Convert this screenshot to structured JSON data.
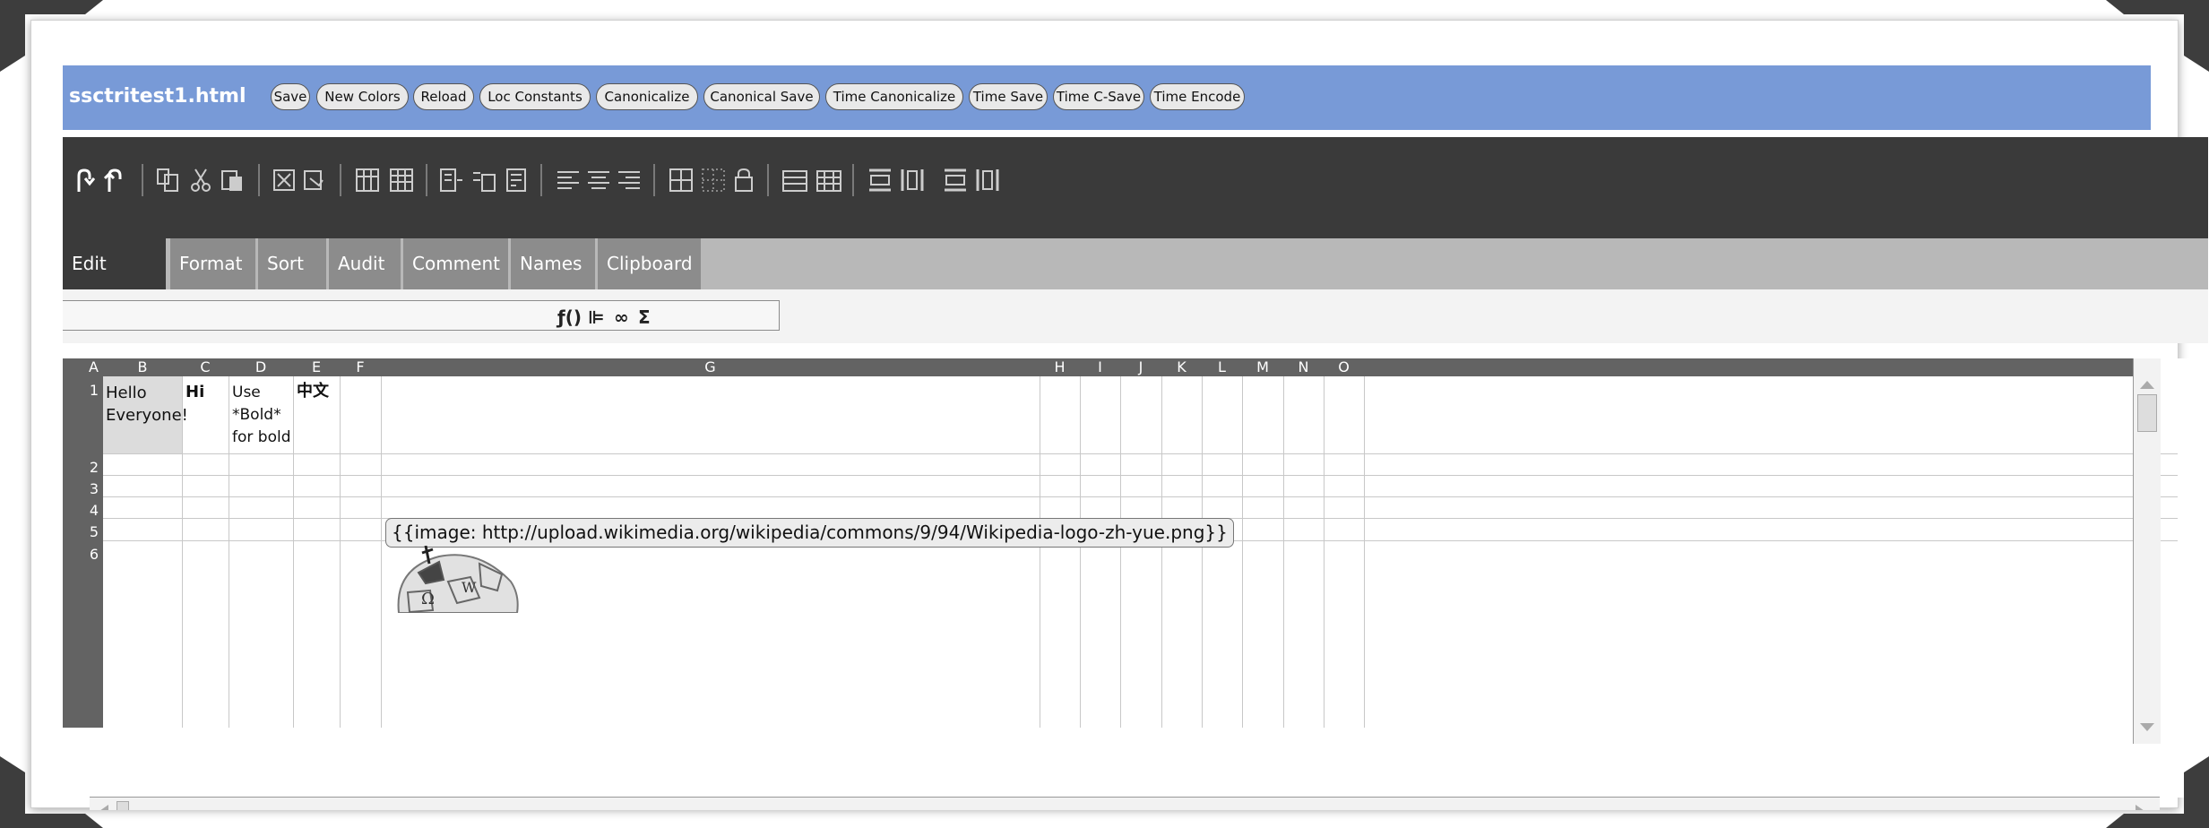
{
  "toolbar_title": {
    "filename": "ssctritest1.html",
    "buttons": [
      "Save",
      "New Colors",
      "Reload",
      "Loc Constants",
      "Canonicalize",
      "Canonical Save",
      "Time Canonicalize",
      "Time Save",
      "Time C-Save",
      "Time Encode"
    ]
  },
  "icons": [
    "undo-icon",
    "redo-icon",
    "copy-icon",
    "cut-icon",
    "paste-icon",
    "delete-icon",
    "paste-formats-icon",
    "lock-icon"
  ],
  "tabs": [
    "Edit",
    "Format",
    "Sort",
    "Audit",
    "Comment",
    "Names",
    "Clipboard"
  ],
  "formula_icons": [
    "ƒ()",
    "⊫",
    "∞",
    "Σ"
  ],
  "columns": [
    "A",
    "B",
    "C",
    "D",
    "E",
    "F",
    "G",
    "H",
    "I",
    "J",
    "K",
    "L",
    "M",
    "N",
    "O"
  ],
  "rows": [
    "1",
    "2",
    "3",
    "4",
    "5",
    "6"
  ],
  "cells": {
    "B1": "Hello Everyone!",
    "C1": "Hi",
    "D1": "Use *Bold* for bold",
    "E1": "中文",
    "G5": "{{image: http://upload.wikimedia.org/wikipedia/commons/9/94/Wikipedia-logo-zh-yue.png}}"
  },
  "colors": {
    "titlebar": "#789ad7",
    "toolbar": "#3a3a3a",
    "tab_active": "#3a3a3a",
    "tab_inactive": "#8c8c8c",
    "header": "#636363"
  }
}
